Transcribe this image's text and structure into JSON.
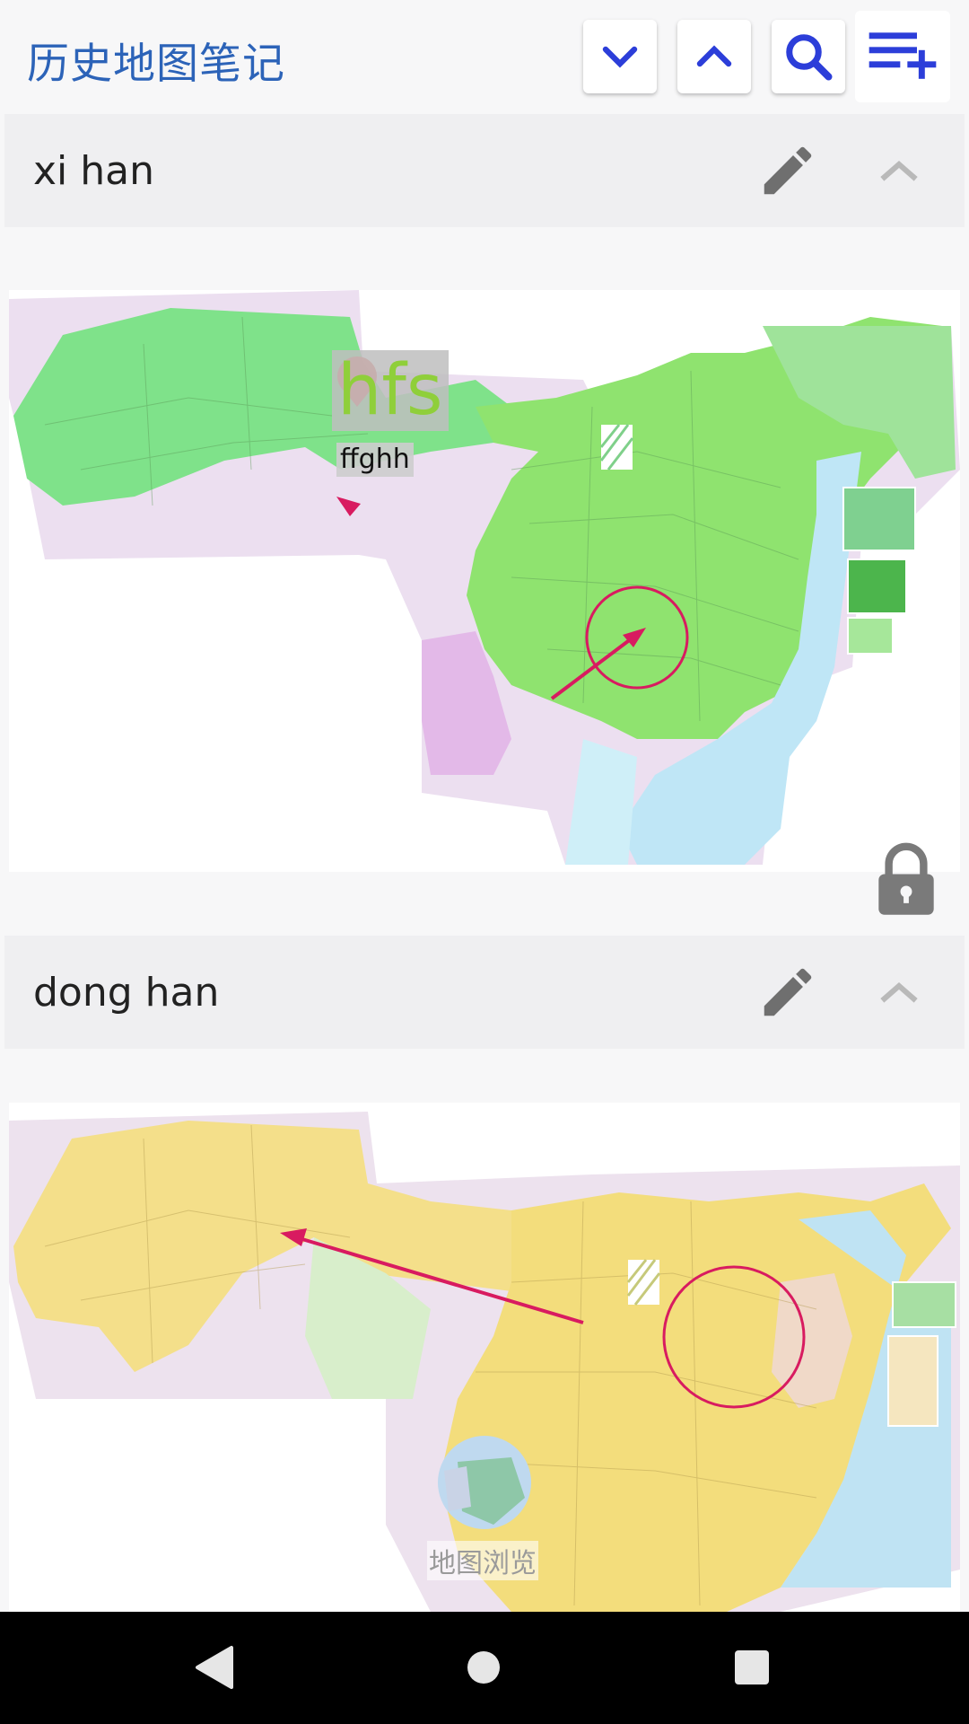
{
  "app": {
    "title": "历史地图笔记"
  },
  "toolbar": {
    "icons": [
      "chevron-down-icon",
      "chevron-up-icon",
      "search-icon",
      "playlist-add-icon"
    ]
  },
  "notes": [
    {
      "title": "xi han",
      "marker_big": "hfs",
      "marker_small": "ffghh",
      "map_theme": "green"
    },
    {
      "title": "dong han",
      "browse_label": "地图浏览",
      "map_theme": "yellow"
    }
  ],
  "colors": {
    "accent": "#2c63b8",
    "annotation": "#d81b60",
    "icon_grey": "#6f6f6f"
  }
}
